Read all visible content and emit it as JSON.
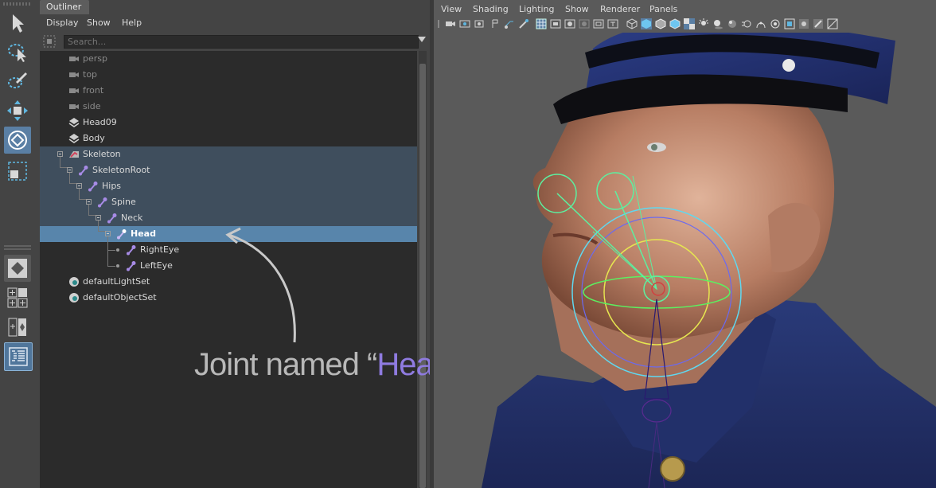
{
  "outliner": {
    "title": "Outliner",
    "menu": [
      "Display",
      "Show",
      "Help"
    ],
    "search_placeholder": "Search...",
    "items": [
      {
        "label": "persp",
        "icon": "camera-icon",
        "style": "dim"
      },
      {
        "label": "top",
        "icon": "camera-icon",
        "style": "dim"
      },
      {
        "label": "front",
        "icon": "camera-icon",
        "style": "dim"
      },
      {
        "label": "side",
        "icon": "camera-icon",
        "style": "dim"
      },
      {
        "label": "Head09",
        "icon": "mesh-icon",
        "style": "normal"
      },
      {
        "label": "Body",
        "icon": "mesh-icon",
        "style": "normal"
      },
      {
        "label": "Skeleton",
        "icon": "skeleton-group-icon",
        "style": "normal"
      },
      {
        "label": "SkeletonRoot",
        "icon": "joint-icon",
        "style": "normal"
      },
      {
        "label": "Hips",
        "icon": "joint-icon",
        "style": "normal"
      },
      {
        "label": "Spine",
        "icon": "joint-icon",
        "style": "normal"
      },
      {
        "label": "Neck",
        "icon": "joint-icon",
        "style": "normal"
      },
      {
        "label": "Head",
        "icon": "joint-icon",
        "style": "selected"
      },
      {
        "label": "RightEye",
        "icon": "joint-icon",
        "style": "normal"
      },
      {
        "label": "LeftEye",
        "icon": "joint-icon",
        "style": "normal"
      },
      {
        "label": "defaultLightSet",
        "icon": "set-icon",
        "style": "normal"
      },
      {
        "label": "defaultObjectSet",
        "icon": "set-icon",
        "style": "normal"
      }
    ],
    "selected_item": "Head"
  },
  "annotation": {
    "prefix": "Joint named “",
    "name": "Head",
    "suffix": "”"
  },
  "viewport": {
    "menu": [
      "View",
      "Shading",
      "Lighting",
      "Show",
      "Renderer",
      "Panels"
    ]
  },
  "toolbox": {
    "tools": [
      "select-arrow-icon",
      "lasso-select-icon",
      "paint-select-icon",
      "move-tool-icon",
      "rotate-tool-icon",
      "scale-tool-icon"
    ],
    "layouts": [
      "single-pane-layout-icon",
      "four-pane-layout-icon",
      "two-pane-layout-icon",
      "outliner-layout-icon"
    ]
  },
  "colors": {
    "selection": "#5885ab",
    "highlight": "#3f4e5d",
    "joint_purple": "#a78be6",
    "annotation_accent": "#8f7be0"
  }
}
